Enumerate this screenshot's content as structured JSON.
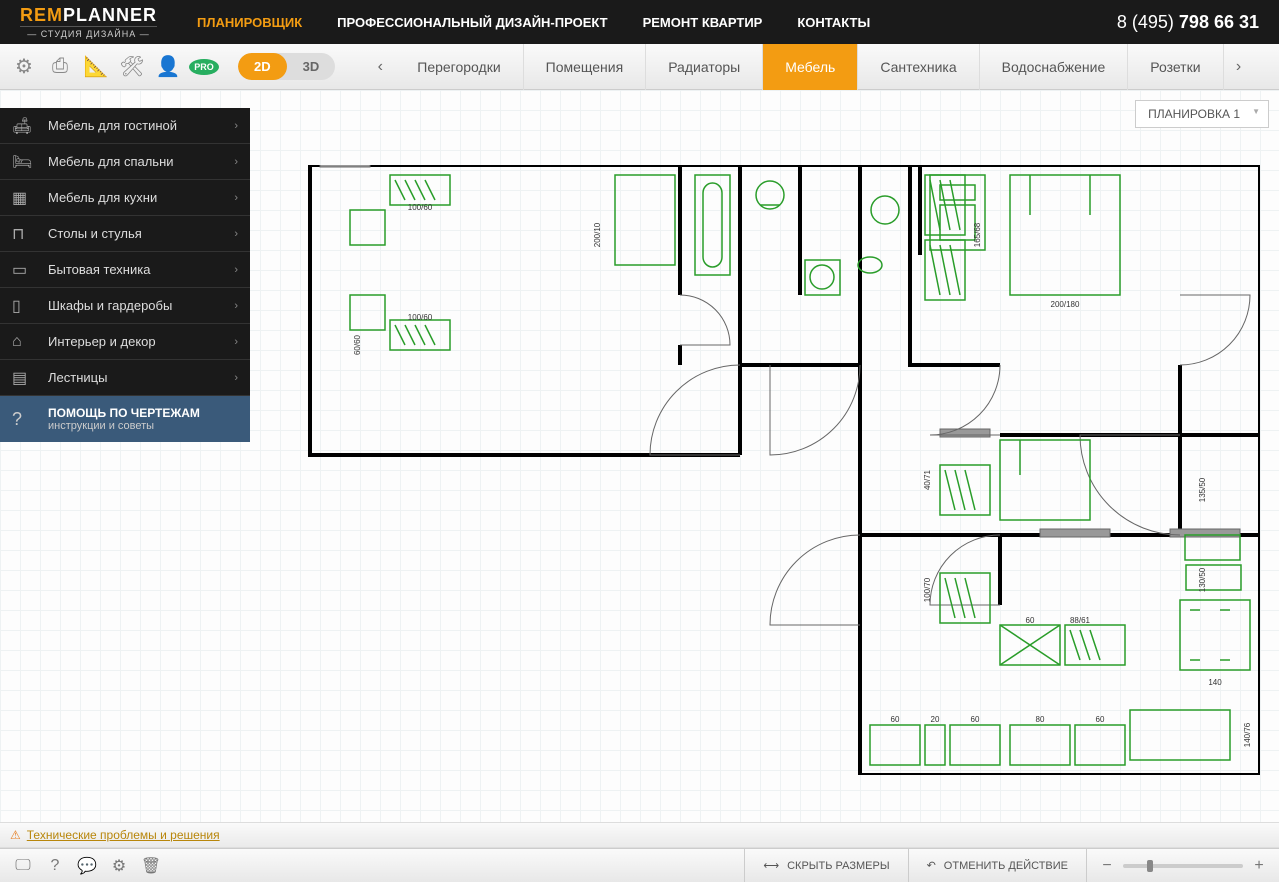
{
  "logo": {
    "rem": "REM",
    "planner": "PLANNER",
    "subtitle": "— СТУДИЯ ДИЗАЙНА —"
  },
  "nav": [
    {
      "label": "ПЛАНИРОВЩИК",
      "active": true
    },
    {
      "label": "ПРОФЕССИОНАЛЬНЫЙ ДИЗАЙН-ПРОЕКТ",
      "active": false
    },
    {
      "label": "РЕМОНТ КВАРТИР",
      "active": false
    },
    {
      "label": "КОНТАКТЫ",
      "active": false
    }
  ],
  "phone": {
    "prefix": "8 (495) ",
    "bold": "798 66 31"
  },
  "pro": "PRO",
  "view": {
    "d2": "2D",
    "d3": "3D"
  },
  "tabs": [
    {
      "label": "Перегородки",
      "active": false
    },
    {
      "label": "Помещения",
      "active": false
    },
    {
      "label": "Радиаторы",
      "active": false
    },
    {
      "label": "Мебель",
      "active": true
    },
    {
      "label": "Сантехника",
      "active": false
    },
    {
      "label": "Водоснабжение",
      "active": false
    },
    {
      "label": "Розетки",
      "active": false
    }
  ],
  "plan_label": "ПЛАНИРОВКА 1",
  "sidebar": [
    {
      "label": "Мебель для гостиной"
    },
    {
      "label": "Мебель для спальни"
    },
    {
      "label": "Мебель для кухни"
    },
    {
      "label": "Столы и стулья"
    },
    {
      "label": "Бытовая техника"
    },
    {
      "label": "Шкафы и гардеробы"
    },
    {
      "label": "Интерьер и декор"
    },
    {
      "label": "Лестницы"
    }
  ],
  "help": {
    "title": "ПОМОЩЬ ПО ЧЕРТЕЖАМ",
    "sub": "инструкции и советы"
  },
  "tech_link": "Технические проблемы и решения",
  "bottom": {
    "hide_sizes": "СКРЫТЬ РАЗМЕРЫ",
    "undo": "ОТМЕНИТЬ ДЕЙСТВИЕ"
  },
  "dimensions": {
    "d1": "100/60",
    "d2": "200/10",
    "d3": "100/60",
    "d4": "60/60",
    "d5": "165/68",
    "d6": "200/180",
    "d7": "40/71",
    "d8": "100/70",
    "d9": "135/50",
    "d10": "130/50",
    "d11": "88/61",
    "d12": "140",
    "d13": "60",
    "d14": "20",
    "d15": "60",
    "d16": "80",
    "d17": "60",
    "d18": "60",
    "d19": "140/76"
  }
}
